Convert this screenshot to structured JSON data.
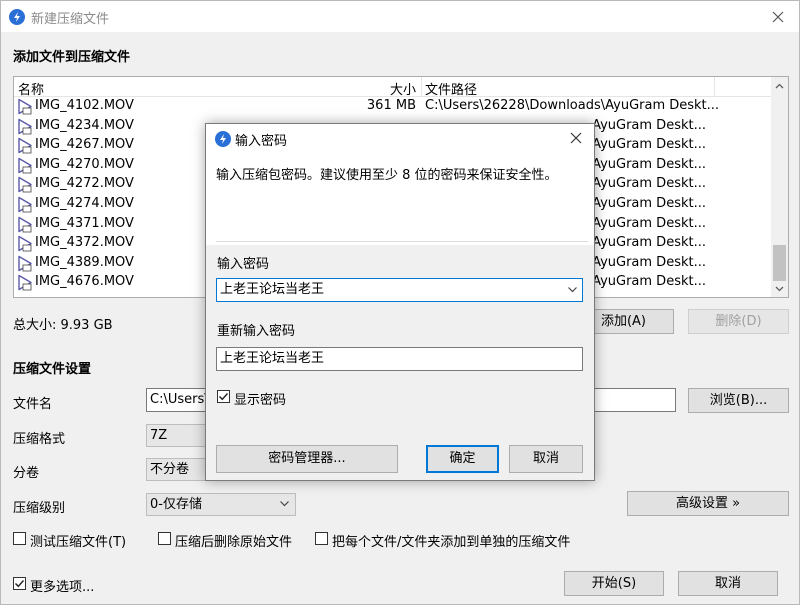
{
  "window": {
    "title": "新建压缩文件"
  },
  "files": {
    "section_title": "添加文件到压缩文件",
    "columns": {
      "name": "名称",
      "size": "大小",
      "path": "文件路径"
    },
    "rows": [
      {
        "name": "IMG_4102.MOV",
        "size": "361 MB",
        "path": "C:\\Users\\26228\\Downloads\\AyuGram Deskt..."
      },
      {
        "name": "IMG_4234.MOV",
        "size": "",
        "path": "AyuGram Deskt..."
      },
      {
        "name": "IMG_4267.MOV",
        "size": "",
        "path": "AyuGram Deskt..."
      },
      {
        "name": "IMG_4270.MOV",
        "size": "",
        "path": "AyuGram Deskt..."
      },
      {
        "name": "IMG_4272.MOV",
        "size": "",
        "path": "AyuGram Deskt..."
      },
      {
        "name": "IMG_4274.MOV",
        "size": "",
        "path": "AyuGram Deskt..."
      },
      {
        "name": "IMG_4371.MOV",
        "size": "",
        "path": "AyuGram Deskt..."
      },
      {
        "name": "IMG_4372.MOV",
        "size": "",
        "path": "AyuGram Deskt..."
      },
      {
        "name": "IMG_4389.MOV",
        "size": "",
        "path": "AyuGram Deskt..."
      },
      {
        "name": "IMG_4676.MOV",
        "size": "",
        "path": "AyuGram Deskt..."
      }
    ],
    "total_size": "总大小: 9.93 GB",
    "add_button": "添加(A)",
    "remove_button": "删除(D)"
  },
  "settings": {
    "section_title": "压缩文件设置",
    "filename_label": "文件名",
    "filename_value": "C:\\Users\\",
    "browse_button": "浏览(B)...",
    "format_label": "压缩格式",
    "format_value": "7Z",
    "split_label": "分卷",
    "split_value": "不分卷",
    "level_label": "压缩级别",
    "level_value": "0-仅存储",
    "advanced_button": "高级设置 »",
    "test_checkbox": "测试压缩文件(T)",
    "delete_checkbox": "压缩后删除原始文件",
    "separate_checkbox": "把每个文件/文件夹添加到单独的压缩文件"
  },
  "footer": {
    "more_options": "更多选项...",
    "start_button": "开始(S)",
    "cancel_button": "取消"
  },
  "dialog": {
    "title": "输入密码",
    "description": "输入压缩包密码。建议使用至少 8 位的密码来保证安全性。",
    "password_label": "输入密码",
    "password_value": "上老王论坛当老王",
    "confirm_label": "重新输入密码",
    "confirm_value": "上老王论坛当老王",
    "show_password": "显示密码",
    "manager_button": "密码管理器...",
    "ok_button": "确定",
    "cancel_button": "取消"
  },
  "colors": {
    "accent": "#0078d7",
    "app_icon": "#2a6fd6"
  }
}
